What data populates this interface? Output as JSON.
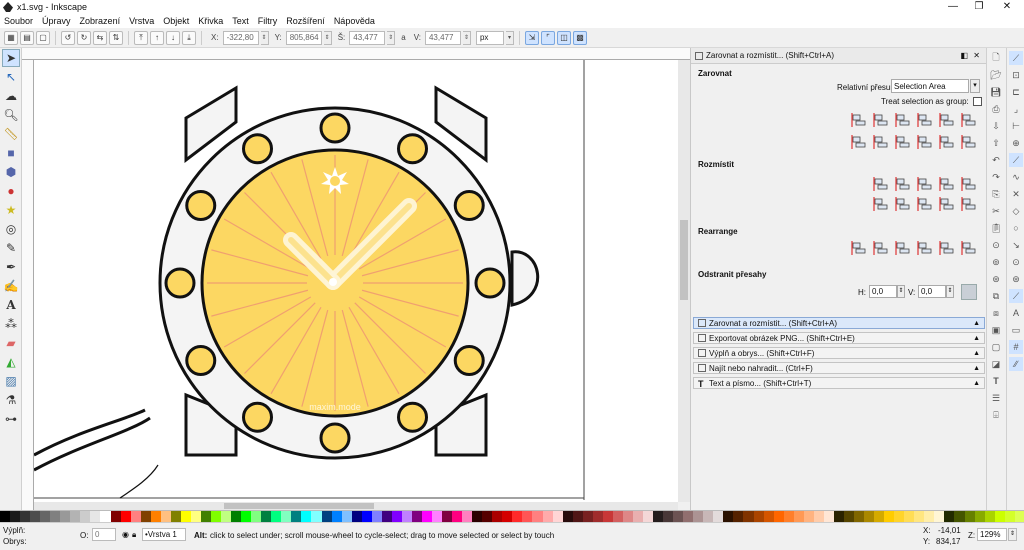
{
  "window": {
    "title": "x1.svg - Inkscape",
    "minimize": "—",
    "maximize": "❐",
    "close": "✕"
  },
  "menu": [
    "Soubor",
    "Úpravy",
    "Zobrazení",
    "Vrstva",
    "Objekt",
    "Křivka",
    "Text",
    "Filtry",
    "Rozšíření",
    "Nápověda"
  ],
  "controls": {
    "x_label": "X:",
    "x_value": "-322,80",
    "y_label": "Y:",
    "y_value": "805,864",
    "w_label": "Š:",
    "w_value": "43,477",
    "lock_label": "a",
    "h_label": "V:",
    "h_value": "43,477",
    "unit": "px"
  },
  "watch": {
    "brand": "maxim.mode"
  },
  "dock": {
    "title": "Zarovnat a rozmístit... (Shift+Ctrl+A)",
    "align_title": "Zarovnat",
    "relative_label": "Relativní přesun:",
    "relative_value": "Selection Area",
    "treat_label": "Treat selection as group:",
    "distribute_title": "Rozmístit",
    "rearrange_title": "Rearrange",
    "overlap_title": "Odstranit přesahy",
    "h_label": "H:",
    "h_value": "0,0",
    "v_label": "V:",
    "v_value": "0,0",
    "panels": [
      {
        "label": "Zarovnat a rozmístit... (Shift+Ctrl+A)",
        "open": true
      },
      {
        "label": "Exportovat obrázek PNG... (Shift+Ctrl+E)",
        "open": false
      },
      {
        "label": "Výplň a obrys... (Shift+Ctrl+F)",
        "open": false
      },
      {
        "label": "Najít nebo nahradit... (Ctrl+F)",
        "open": false
      },
      {
        "label": "Text a písmo... (Shift+Ctrl+T)",
        "open": false
      }
    ]
  },
  "status": {
    "fill_label": "Výplň:",
    "stroke_label": "Obrys:",
    "opacity_label": "O:",
    "opacity_value": "0",
    "layer": "•Vrstva 1",
    "message_bold": "Alt:",
    "message": "click to select under; scroll mouse-wheel to cycle-select; drag to move selected or select by touch",
    "x_label": "X:",
    "x_value": "-14,01",
    "y_label": "Y:",
    "y_value": "834,17",
    "zoom_label": "Z:",
    "zoom_value": "129%"
  },
  "colors": {
    "dial": "#fcd762",
    "accent": "#4a90e2"
  }
}
